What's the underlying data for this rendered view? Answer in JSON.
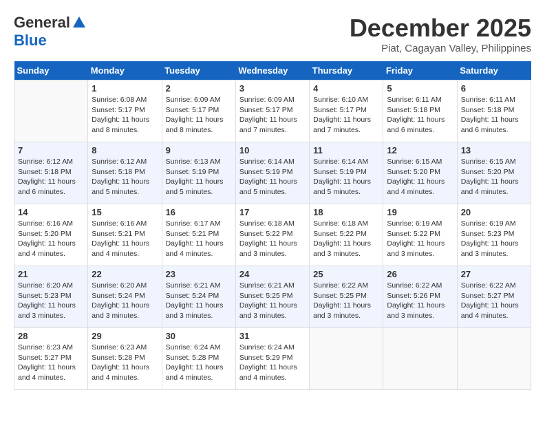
{
  "header": {
    "logo_general": "General",
    "logo_blue": "Blue",
    "month_title": "December 2025",
    "location": "Piat, Cagayan Valley, Philippines"
  },
  "days_of_week": [
    "Sunday",
    "Monday",
    "Tuesday",
    "Wednesday",
    "Thursday",
    "Friday",
    "Saturday"
  ],
  "weeks": [
    [
      {
        "day": "",
        "info": ""
      },
      {
        "day": "1",
        "info": "Sunrise: 6:08 AM\nSunset: 5:17 PM\nDaylight: 11 hours and 8 minutes."
      },
      {
        "day": "2",
        "info": "Sunrise: 6:09 AM\nSunset: 5:17 PM\nDaylight: 11 hours and 8 minutes."
      },
      {
        "day": "3",
        "info": "Sunrise: 6:09 AM\nSunset: 5:17 PM\nDaylight: 11 hours and 7 minutes."
      },
      {
        "day": "4",
        "info": "Sunrise: 6:10 AM\nSunset: 5:17 PM\nDaylight: 11 hours and 7 minutes."
      },
      {
        "day": "5",
        "info": "Sunrise: 6:11 AM\nSunset: 5:18 PM\nDaylight: 11 hours and 6 minutes."
      },
      {
        "day": "6",
        "info": "Sunrise: 6:11 AM\nSunset: 5:18 PM\nDaylight: 11 hours and 6 minutes."
      }
    ],
    [
      {
        "day": "7",
        "info": "Sunrise: 6:12 AM\nSunset: 5:18 PM\nDaylight: 11 hours and 6 minutes."
      },
      {
        "day": "8",
        "info": "Sunrise: 6:12 AM\nSunset: 5:18 PM\nDaylight: 11 hours and 5 minutes."
      },
      {
        "day": "9",
        "info": "Sunrise: 6:13 AM\nSunset: 5:19 PM\nDaylight: 11 hours and 5 minutes."
      },
      {
        "day": "10",
        "info": "Sunrise: 6:14 AM\nSunset: 5:19 PM\nDaylight: 11 hours and 5 minutes."
      },
      {
        "day": "11",
        "info": "Sunrise: 6:14 AM\nSunset: 5:19 PM\nDaylight: 11 hours and 5 minutes."
      },
      {
        "day": "12",
        "info": "Sunrise: 6:15 AM\nSunset: 5:20 PM\nDaylight: 11 hours and 4 minutes."
      },
      {
        "day": "13",
        "info": "Sunrise: 6:15 AM\nSunset: 5:20 PM\nDaylight: 11 hours and 4 minutes."
      }
    ],
    [
      {
        "day": "14",
        "info": "Sunrise: 6:16 AM\nSunset: 5:20 PM\nDaylight: 11 hours and 4 minutes."
      },
      {
        "day": "15",
        "info": "Sunrise: 6:16 AM\nSunset: 5:21 PM\nDaylight: 11 hours and 4 minutes."
      },
      {
        "day": "16",
        "info": "Sunrise: 6:17 AM\nSunset: 5:21 PM\nDaylight: 11 hours and 4 minutes."
      },
      {
        "day": "17",
        "info": "Sunrise: 6:18 AM\nSunset: 5:22 PM\nDaylight: 11 hours and 3 minutes."
      },
      {
        "day": "18",
        "info": "Sunrise: 6:18 AM\nSunset: 5:22 PM\nDaylight: 11 hours and 3 minutes."
      },
      {
        "day": "19",
        "info": "Sunrise: 6:19 AM\nSunset: 5:22 PM\nDaylight: 11 hours and 3 minutes."
      },
      {
        "day": "20",
        "info": "Sunrise: 6:19 AM\nSunset: 5:23 PM\nDaylight: 11 hours and 3 minutes."
      }
    ],
    [
      {
        "day": "21",
        "info": "Sunrise: 6:20 AM\nSunset: 5:23 PM\nDaylight: 11 hours and 3 minutes."
      },
      {
        "day": "22",
        "info": "Sunrise: 6:20 AM\nSunset: 5:24 PM\nDaylight: 11 hours and 3 minutes."
      },
      {
        "day": "23",
        "info": "Sunrise: 6:21 AM\nSunset: 5:24 PM\nDaylight: 11 hours and 3 minutes."
      },
      {
        "day": "24",
        "info": "Sunrise: 6:21 AM\nSunset: 5:25 PM\nDaylight: 11 hours and 3 minutes."
      },
      {
        "day": "25",
        "info": "Sunrise: 6:22 AM\nSunset: 5:25 PM\nDaylight: 11 hours and 3 minutes."
      },
      {
        "day": "26",
        "info": "Sunrise: 6:22 AM\nSunset: 5:26 PM\nDaylight: 11 hours and 3 minutes."
      },
      {
        "day": "27",
        "info": "Sunrise: 6:22 AM\nSunset: 5:27 PM\nDaylight: 11 hours and 4 minutes."
      }
    ],
    [
      {
        "day": "28",
        "info": "Sunrise: 6:23 AM\nSunset: 5:27 PM\nDaylight: 11 hours and 4 minutes."
      },
      {
        "day": "29",
        "info": "Sunrise: 6:23 AM\nSunset: 5:28 PM\nDaylight: 11 hours and 4 minutes."
      },
      {
        "day": "30",
        "info": "Sunrise: 6:24 AM\nSunset: 5:28 PM\nDaylight: 11 hours and 4 minutes."
      },
      {
        "day": "31",
        "info": "Sunrise: 6:24 AM\nSunset: 5:29 PM\nDaylight: 11 hours and 4 minutes."
      },
      {
        "day": "",
        "info": ""
      },
      {
        "day": "",
        "info": ""
      },
      {
        "day": "",
        "info": ""
      }
    ]
  ]
}
